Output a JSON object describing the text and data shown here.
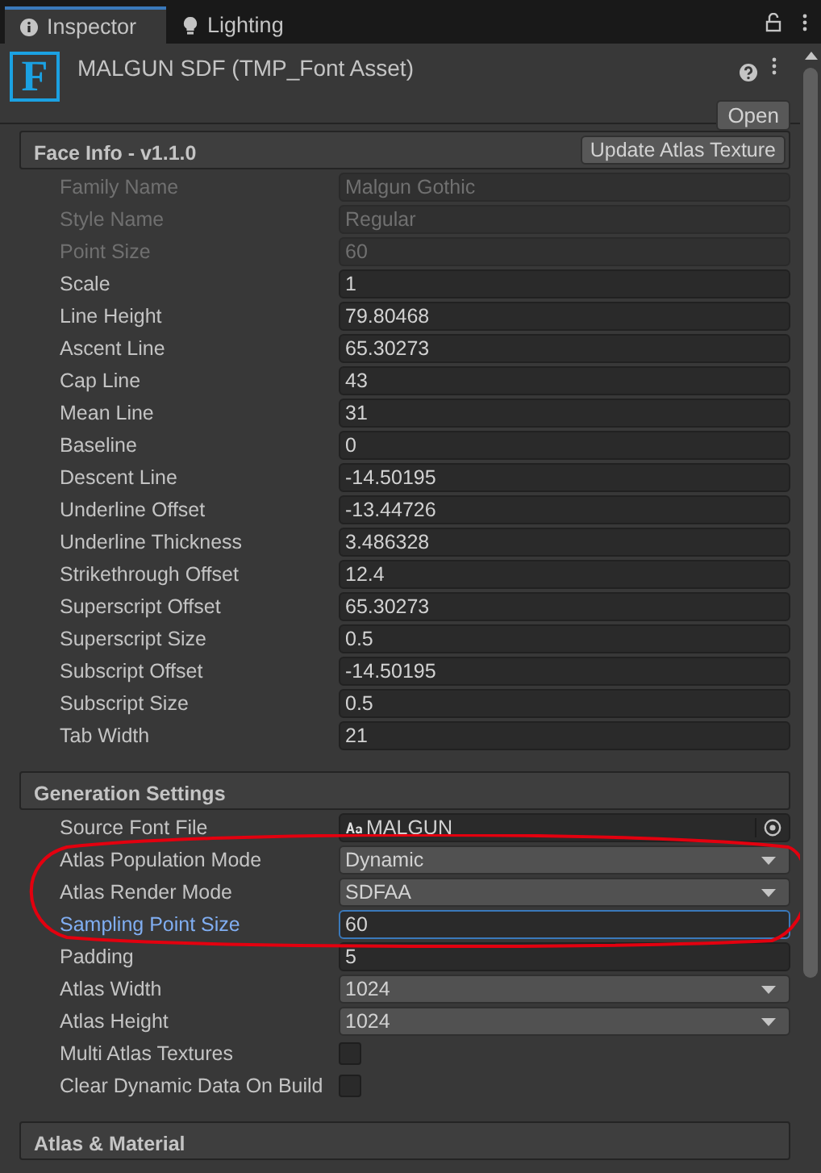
{
  "tabs": [
    {
      "label": "Inspector",
      "selected": true
    },
    {
      "label": "Lighting",
      "selected": false
    }
  ],
  "asset": {
    "icon_letter": "F",
    "title": "MALGUN SDF (TMP_Font Asset)",
    "open_button": "Open"
  },
  "sections": [
    {
      "title": "Face Info - v1.1.0",
      "button": "Update Atlas Texture",
      "properties": [
        {
          "label": "Family Name",
          "value": "Malgun Gothic",
          "kind": "text",
          "disabled": true,
          "focused": false,
          "circled": false
        },
        {
          "label": "Style Name",
          "value": "Regular",
          "kind": "text",
          "disabled": true,
          "focused": false,
          "circled": false
        },
        {
          "label": "Point Size",
          "value": "60",
          "kind": "text",
          "disabled": true,
          "focused": false,
          "circled": false
        },
        {
          "label": "Scale",
          "value": "1",
          "kind": "text",
          "disabled": false,
          "focused": false,
          "circled": false
        },
        {
          "label": "Line Height",
          "value": "79.80468",
          "kind": "text",
          "disabled": false,
          "focused": false,
          "circled": false
        },
        {
          "label": "Ascent Line",
          "value": "65.30273",
          "kind": "text",
          "disabled": false,
          "focused": false,
          "circled": false
        },
        {
          "label": "Cap Line",
          "value": "43",
          "kind": "text",
          "disabled": false,
          "focused": false,
          "circled": false
        },
        {
          "label": "Mean Line",
          "value": "31",
          "kind": "text",
          "disabled": false,
          "focused": false,
          "circled": false
        },
        {
          "label": "Baseline",
          "value": "0",
          "kind": "text",
          "disabled": false,
          "focused": false,
          "circled": false
        },
        {
          "label": "Descent Line",
          "value": "-14.50195",
          "kind": "text",
          "disabled": false,
          "focused": false,
          "circled": false
        },
        {
          "label": "Underline Offset",
          "value": "-13.44726",
          "kind": "text",
          "disabled": false,
          "focused": false,
          "circled": false
        },
        {
          "label": "Underline Thickness",
          "value": "3.486328",
          "kind": "text",
          "disabled": false,
          "focused": false,
          "circled": false
        },
        {
          "label": "Strikethrough Offset",
          "value": "12.4",
          "kind": "text",
          "disabled": false,
          "focused": false,
          "circled": false
        },
        {
          "label": "Superscript Offset",
          "value": "65.30273",
          "kind": "text",
          "disabled": false,
          "focused": false,
          "circled": false
        },
        {
          "label": "Superscript Size",
          "value": "0.5",
          "kind": "text",
          "disabled": false,
          "focused": false,
          "circled": false
        },
        {
          "label": "Subscript Offset",
          "value": "-14.50195",
          "kind": "text",
          "disabled": false,
          "focused": false,
          "circled": false
        },
        {
          "label": "Subscript Size",
          "value": "0.5",
          "kind": "text",
          "disabled": false,
          "focused": false,
          "circled": false
        },
        {
          "label": "Tab Width",
          "value": "21",
          "kind": "text",
          "disabled": false,
          "focused": false,
          "circled": false
        }
      ]
    },
    {
      "title": "Generation Settings",
      "properties": [
        {
          "label": "Source Font File",
          "value": "MALGUN",
          "kind": "object",
          "disabled": false,
          "focused": false,
          "circled": false
        },
        {
          "label": "Atlas Population Mode",
          "value": "Dynamic",
          "kind": "dropdown",
          "disabled": false,
          "focused": false,
          "circled": true
        },
        {
          "label": "Atlas Render Mode",
          "value": "SDFAA",
          "kind": "dropdown",
          "disabled": false,
          "focused": false,
          "circled": true
        },
        {
          "label": "Sampling Point Size",
          "value": "60",
          "kind": "text",
          "disabled": false,
          "focused": true,
          "circled": true
        },
        {
          "label": "Padding",
          "value": "5",
          "kind": "text",
          "disabled": false,
          "focused": false,
          "circled": false
        },
        {
          "label": "Atlas Width",
          "value": "1024",
          "kind": "dropdown",
          "disabled": false,
          "focused": false,
          "circled": false
        },
        {
          "label": "Atlas Height",
          "value": "1024",
          "kind": "dropdown",
          "disabled": false,
          "focused": false,
          "circled": false
        },
        {
          "label": "Multi Atlas Textures",
          "kind": "checkbox",
          "checked": false,
          "disabled": false,
          "focused": false,
          "circled": false
        },
        {
          "label": "Clear Dynamic Data On Build",
          "kind": "checkbox",
          "checked": false,
          "disabled": false,
          "focused": false,
          "circled": false
        }
      ]
    },
    {
      "title": "Atlas & Material"
    }
  ]
}
